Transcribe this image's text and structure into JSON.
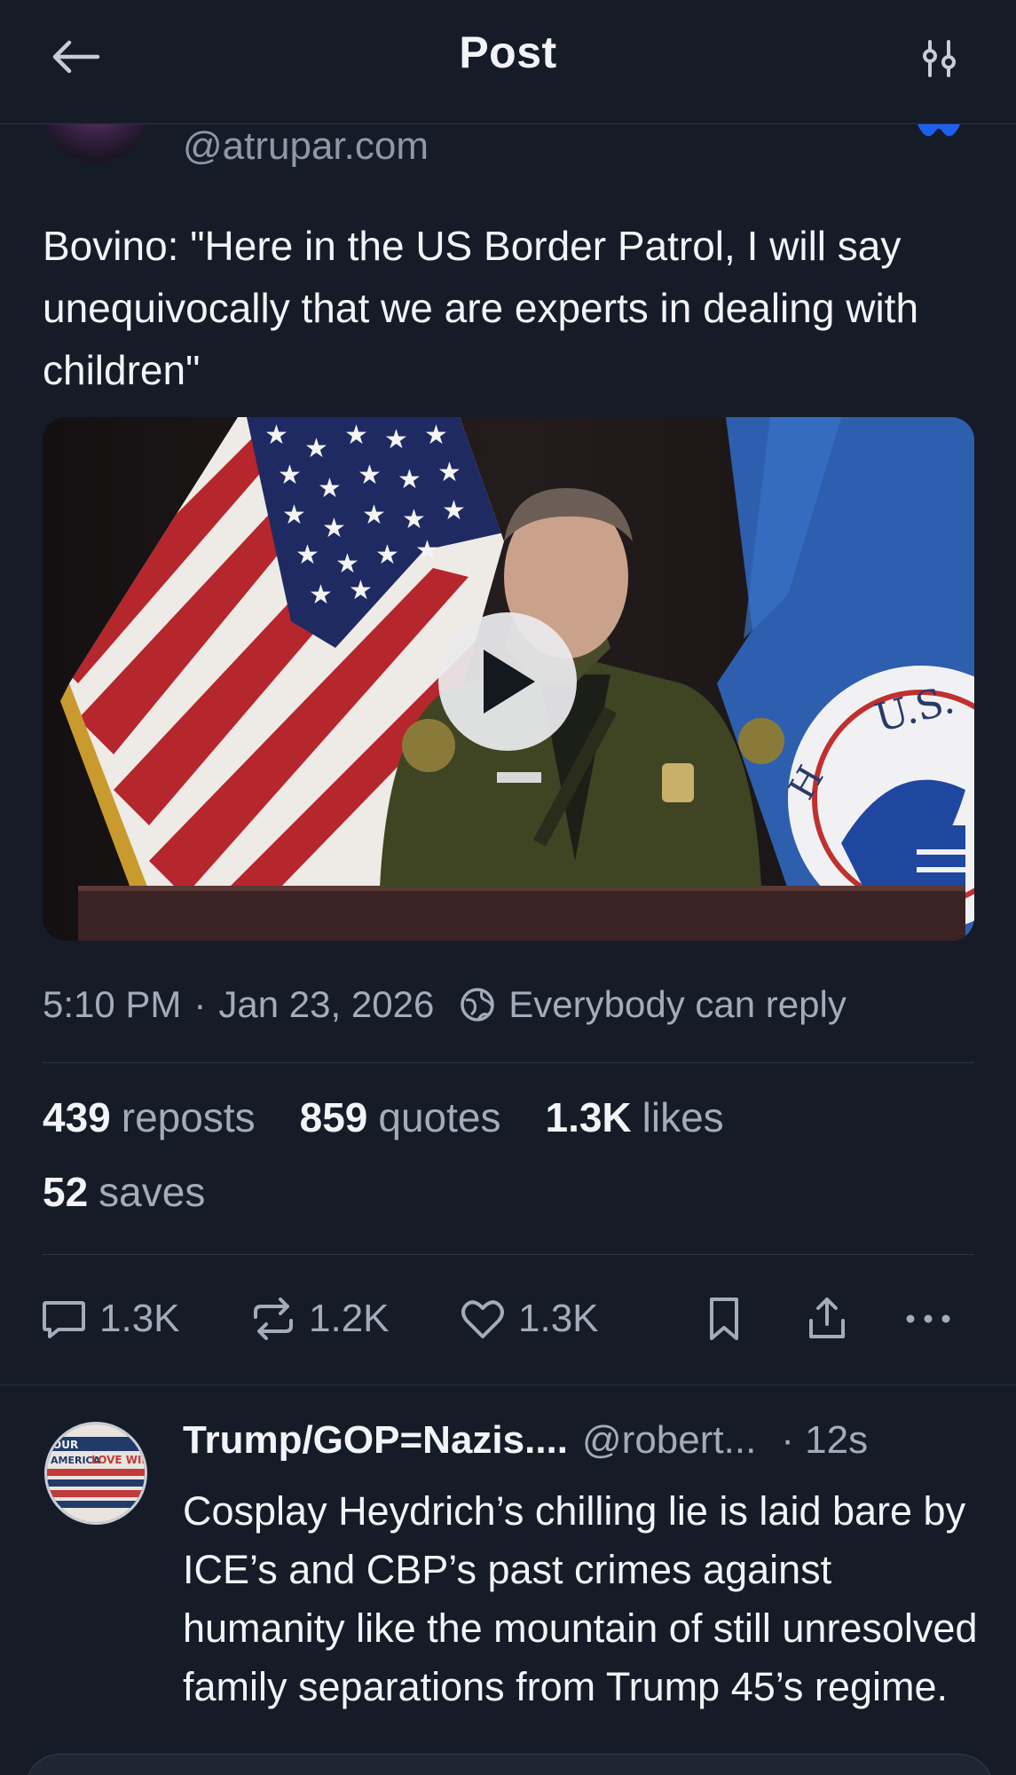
{
  "header": {
    "title": "Post",
    "back_icon": "arrow-left-icon",
    "filter_icon": "sliders-icon"
  },
  "author": {
    "handle": "@atrupar.com"
  },
  "post": {
    "text": "Bovino: \"Here in the US Border Patrol, I will say unequivocally that we are experts in dealing with children\"",
    "video": {
      "play_icon": "play-icon",
      "seal_text": "U.S."
    },
    "time": "5:10 PM",
    "date": "Jan 23, 2026",
    "reply_setting": "Everybody can reply"
  },
  "stats": {
    "reposts_count": "439",
    "reposts_label": "reposts",
    "quotes_count": "859",
    "quotes_label": "quotes",
    "likes_count": "1.3K",
    "likes_label": "likes",
    "saves_count": "52",
    "saves_label": "saves"
  },
  "actions": {
    "replies": "1.3K",
    "reposts": "1.2K",
    "likes": "1.3K"
  },
  "reply": {
    "name": "Trump/GOP=Nazis....",
    "handle": "@robert...",
    "time": "· 12s",
    "text": "Cosplay Heydrich’s chilling lie is laid bare by ICE’s and CBP’s past crimes against humanity like the mountain of still unresolved family separations from Trump 45’s regime.",
    "avatar_sign_text": [
      "OUR",
      "AMERICA",
      "LOVE WINS"
    ]
  },
  "colors": {
    "background": "#161c27",
    "verified": "#1f5ff0",
    "muted": "#a4acb9"
  }
}
